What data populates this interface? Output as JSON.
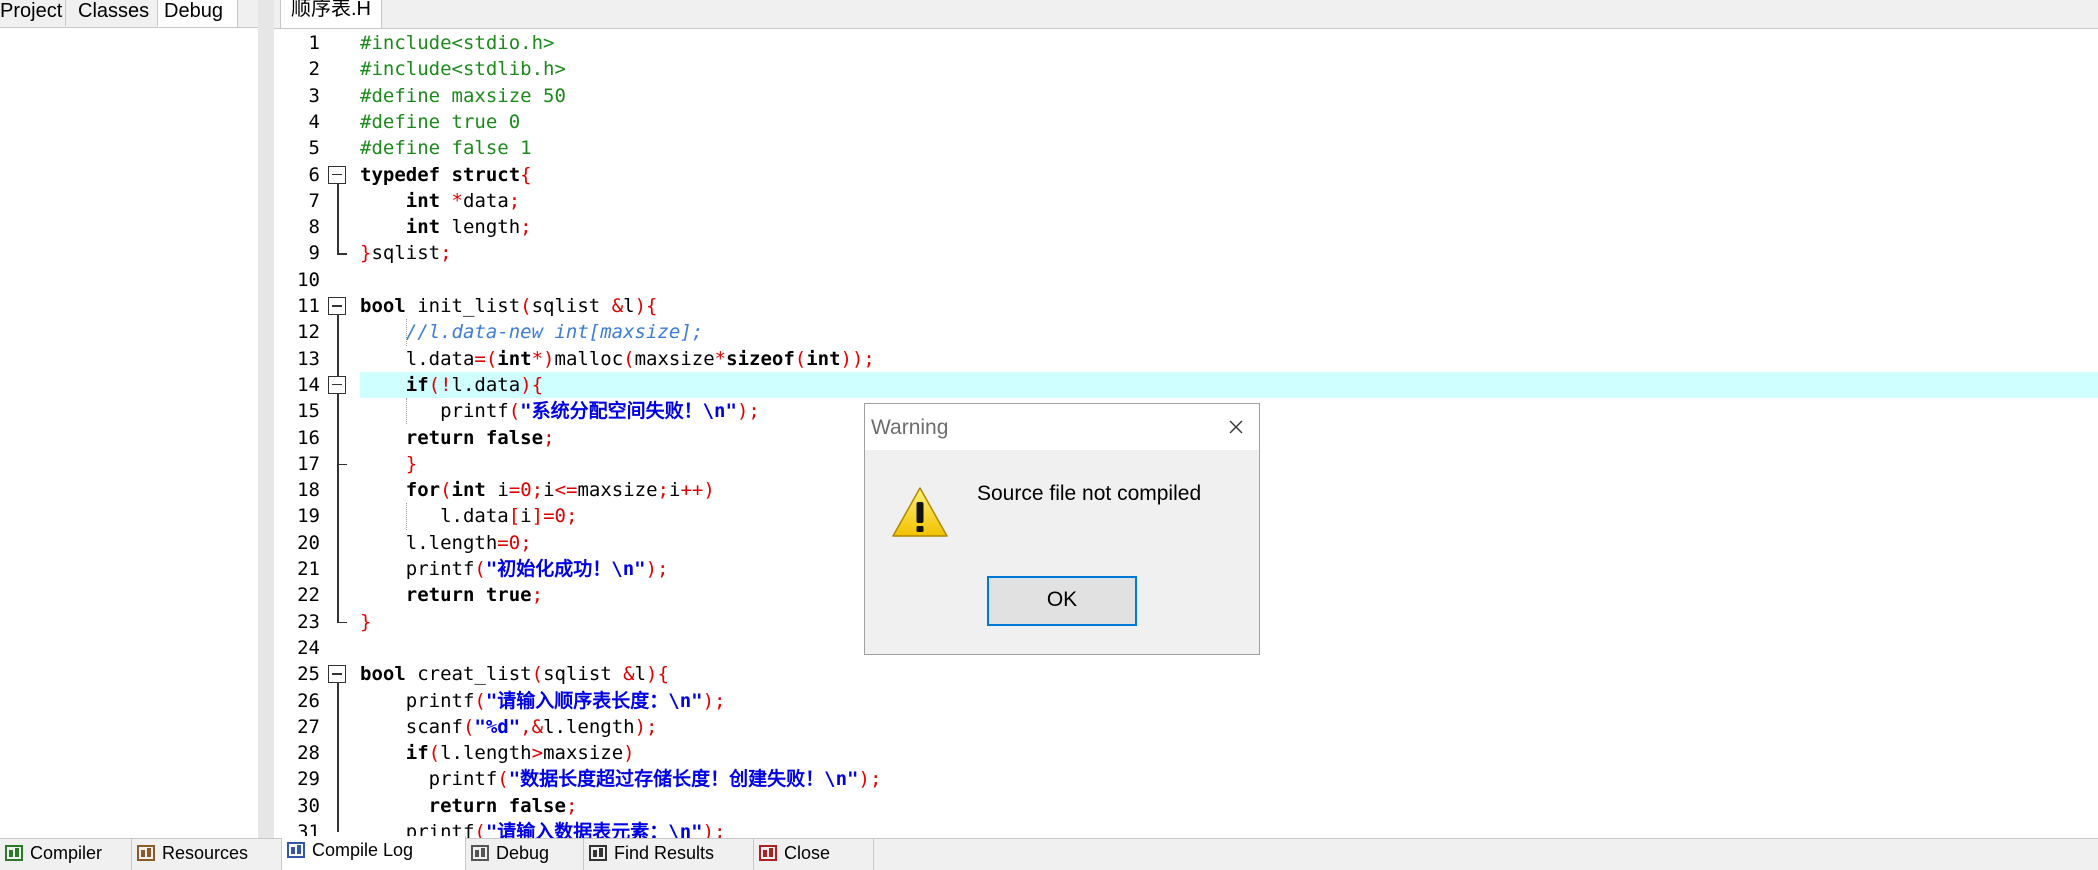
{
  "left_panel": {
    "tabs": [
      "Project",
      "Classes",
      "Debug"
    ],
    "active_tab": "Debug"
  },
  "editor": {
    "tab_label": "顺序表.H",
    "highlight_color": "#cfffff",
    "lines": [
      {
        "n": "1",
        "html": "<span class='pp'>#include&lt;stdio.h&gt;</span>"
      },
      {
        "n": "2",
        "html": "<span class='pp'>#include&lt;stdlib.h&gt;</span>"
      },
      {
        "n": "3",
        "html": "<span class='pp'>#define maxsize 50</span>"
      },
      {
        "n": "4",
        "html": "<span class='pp'>#define true 0</span>"
      },
      {
        "n": "5",
        "html": "<span class='pp'>#define false 1</span>"
      },
      {
        "n": "6",
        "html": "<span class='kw'>typedef</span> <span class='kw'>struct</span><span class='sym'>{</span>"
      },
      {
        "n": "7",
        "html": "    <span class='kw'>int</span> <span class='sym'>*</span>data<span class='sym'>;</span>"
      },
      {
        "n": "8",
        "html": "    <span class='kw'>int</span> length<span class='sym'>;</span>"
      },
      {
        "n": "9",
        "html": "<span class='sym'>}</span>sqlist<span class='sym'>;</span>"
      },
      {
        "n": "10",
        "html": ""
      },
      {
        "n": "11",
        "html": "<span class='kw'>bool</span> init_list<span class='sym'>(</span>sqlist <span class='sym'>&amp;</span>l<span class='sym'>){</span>"
      },
      {
        "n": "12",
        "html": "    <span class='cmt'>//l.data-new int[maxsize];</span>"
      },
      {
        "n": "13",
        "html": "    l.data<span class='sym'>=(</span><span class='kw'>int</span><span class='sym'>*)</span>malloc<span class='sym'>(</span>maxsize<span class='sym'>*</span><span class='kw'>sizeof</span><span class='sym'>(</span><span class='kw'>int</span><span class='sym'>));</span>"
      },
      {
        "n": "14",
        "html": "    <span class='kw'>if</span><span class='sym'>(!</span>l.data<span class='sym'>){</span>",
        "highlight": true
      },
      {
        "n": "15",
        "html": "       printf<span class='sym'>(</span><span class='str'>\"系统分配空间失败！\\n\"</span><span class='sym'>);</span>"
      },
      {
        "n": "16",
        "html": "    <span class='kw'>return</span> <span class='kw'>false</span><span class='sym'>;</span>"
      },
      {
        "n": "17",
        "html": "    <span class='sym'>}</span>"
      },
      {
        "n": "18",
        "html": "    <span class='kw'>for</span><span class='sym'>(</span><span class='kw'>int</span> i<span class='sym'>=</span><span class='num'>0</span><span class='sym'>;</span>i<span class='sym'>&lt;=</span>maxsize<span class='sym'>;</span>i<span class='sym'>++)</span>"
      },
      {
        "n": "19",
        "html": "       l.data<span class='sym'>[</span>i<span class='sym'>]=</span><span class='num'>0</span><span class='sym'>;</span>"
      },
      {
        "n": "20",
        "html": "    l.length<span class='sym'>=</span><span class='num'>0</span><span class='sym'>;</span>"
      },
      {
        "n": "21",
        "html": "    printf<span class='sym'>(</span><span class='str'>\"初始化成功！\\n\"</span><span class='sym'>);</span>"
      },
      {
        "n": "22",
        "html": "    <span class='kw'>return</span> <span class='kw'>true</span><span class='sym'>;</span>"
      },
      {
        "n": "23",
        "html": "<span class='sym'>}</span>"
      },
      {
        "n": "24",
        "html": ""
      },
      {
        "n": "25",
        "html": "<span class='kw'>bool</span> creat_list<span class='sym'>(</span>sqlist <span class='sym'>&amp;</span>l<span class='sym'>){</span>"
      },
      {
        "n": "26",
        "html": "    printf<span class='sym'>(</span><span class='str'>\"请输入顺序表长度：\\n\"</span><span class='sym'>);</span>"
      },
      {
        "n": "27",
        "html": "    scanf<span class='sym'>(</span><span class='str'>\"%d\"</span><span class='sym'>,&amp;</span>l.length<span class='sym'>);</span>"
      },
      {
        "n": "28",
        "html": "    <span class='kw'>if</span><span class='sym'>(</span>l.length<span class='sym'>&gt;</span>maxsize<span class='sym'>)</span>"
      },
      {
        "n": "29",
        "html": "      printf<span class='sym'>(</span><span class='str'>\"数据长度超过存储长度！创建失败！\\n\"</span><span class='sym'>);</span>"
      },
      {
        "n": "30",
        "html": "      <span class='kw'>return</span> <span class='kw'>false</span><span class='sym'>;</span>"
      },
      {
        "n": "31",
        "html": "    printf<span class='sym'>(</span><span class='str'>\"请输入数据表元素：\\n\"</span><span class='sym'>);</span>"
      }
    ]
  },
  "bottom_tabs": [
    {
      "label": "Compiler",
      "icon": "compiler-icon"
    },
    {
      "label": "Resources",
      "icon": "resources-icon"
    },
    {
      "label": "Compile Log",
      "icon": "compile-log-icon",
      "active": true
    },
    {
      "label": "Debug",
      "icon": "debug-icon"
    },
    {
      "label": "Find Results",
      "icon": "find-results-icon"
    },
    {
      "label": "Close",
      "icon": "close-icon"
    }
  ],
  "dialog": {
    "title": "Warning",
    "message": "Source file not compiled",
    "ok_label": "OK",
    "icon": "warning-icon"
  }
}
